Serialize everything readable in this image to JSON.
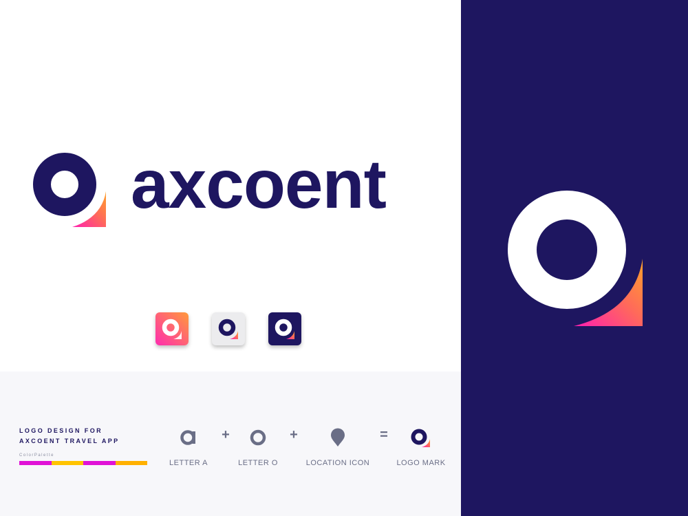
{
  "brand": {
    "wordmark": "axcoent",
    "colors": {
      "navy": "#1e1660",
      "pink": "#ff2fa8",
      "orange": "#ff9930",
      "yellow": "#ffc300",
      "magenta": "#e012d6",
      "slate": "#6a6e86"
    }
  },
  "app_icons": [
    {
      "variant": "gradient",
      "icon": "logo-mark-icon"
    },
    {
      "variant": "light",
      "icon": "logo-mark-icon"
    },
    {
      "variant": "dark",
      "icon": "logo-mark-icon"
    }
  ],
  "info": {
    "tagline_line1": "LOGO DESIGN FOR",
    "tagline_line2": "AXCOENT TRAVEL APP",
    "palette_label": "ColorPalette",
    "palette": [
      "#e012d6",
      "#ffc300",
      "#e012d6",
      "#ffb000"
    ]
  },
  "composition": {
    "items": [
      {
        "label": "LETTER A",
        "icon": "letter-a-icon"
      },
      {
        "label": "LETTER O",
        "icon": "letter-o-icon"
      },
      {
        "label": "LOCATION ICON",
        "icon": "location-pin-icon"
      },
      {
        "label": "LOGO MARK",
        "icon": "logo-mark-icon"
      }
    ],
    "operators": [
      "+",
      "+",
      "="
    ]
  }
}
